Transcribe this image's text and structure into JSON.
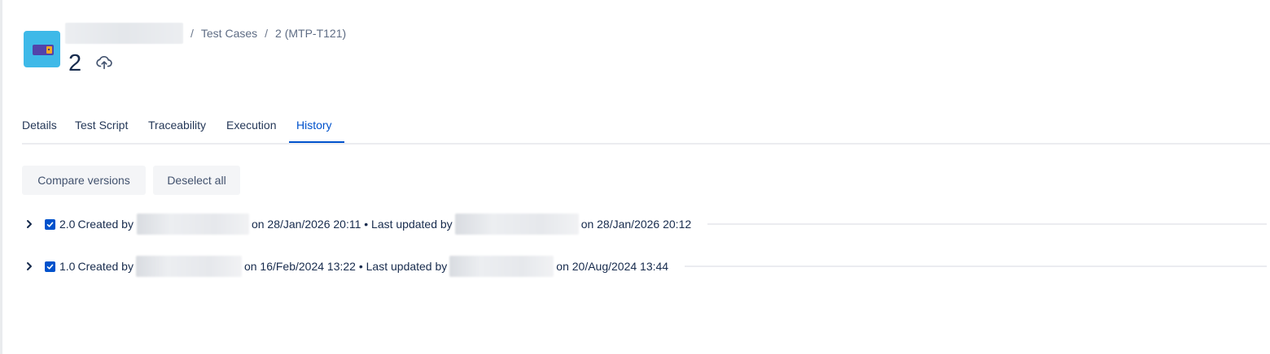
{
  "breadcrumb": {
    "items": [
      "Test Cases",
      "2 (MTP-T121)"
    ],
    "separator": "/"
  },
  "page": {
    "title": "2"
  },
  "tabs": [
    {
      "label": "Details",
      "active": false
    },
    {
      "label": "Test Script",
      "active": false
    },
    {
      "label": "Traceability",
      "active": false
    },
    {
      "label": "Execution",
      "active": false
    },
    {
      "label": "History",
      "active": true
    }
  ],
  "actions": {
    "compare_label": "Compare versions",
    "deselect_label": "Deselect all"
  },
  "versions": [
    {
      "version": "2.0",
      "created_prefix": "Created by",
      "created_on": "on 28/Jan/2026 20:11 • Last updated by",
      "updated_on": "on 28/Jan/2026 20:12",
      "selected": true
    },
    {
      "version": "1.0",
      "created_prefix": "Created by",
      "created_on": "on 16/Feb/2024 13:22 • Last updated by",
      "updated_on": "on 20/Aug/2024 13:44",
      "selected": true
    }
  ],
  "colors": {
    "accent": "#0052cc",
    "avatar_bg": "#3eb9e8",
    "button_bg": "#f4f5f7"
  }
}
